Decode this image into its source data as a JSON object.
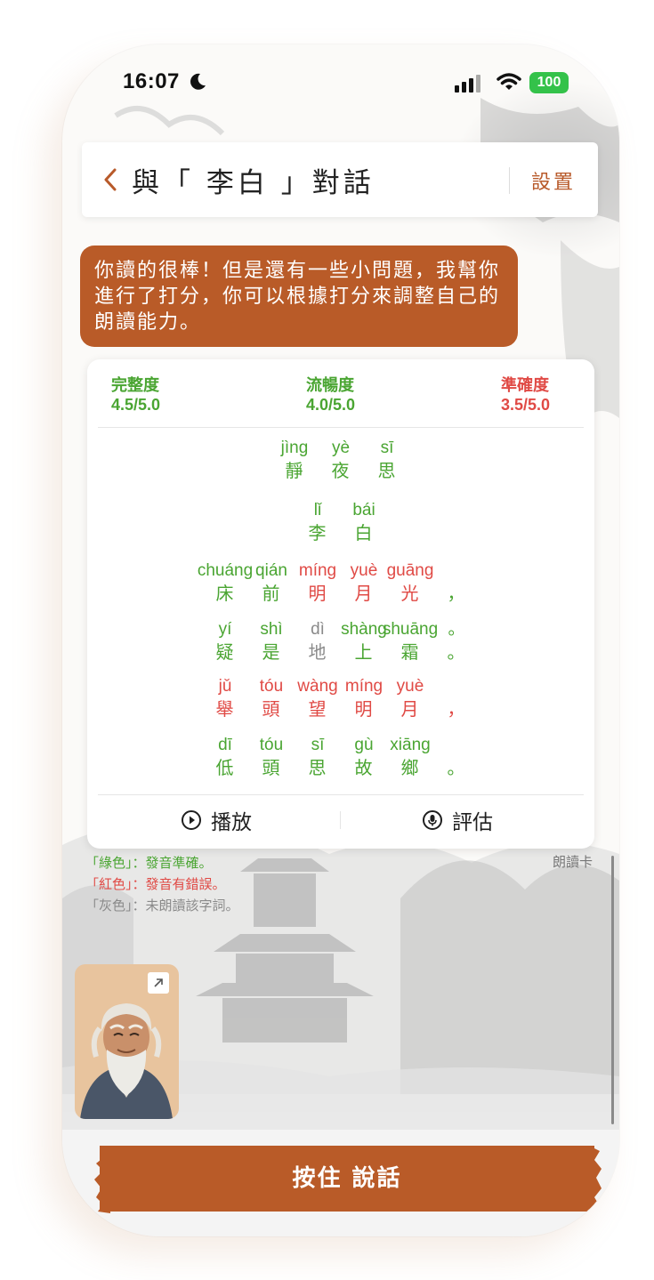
{
  "status_bar": {
    "time": "16:07",
    "battery": "100"
  },
  "nav": {
    "title": "與「 李白 」對話",
    "settings_label": "設置"
  },
  "message": {
    "text": "你讀的很棒！但是還有一些小問題，我幫你進行了打分，你可以根據打分來調整自己的朗讀能力。"
  },
  "scores": [
    {
      "label": "完整度",
      "value": "4.5/5.0"
    },
    {
      "label": "流暢度",
      "value": "4.0/5.0"
    },
    {
      "label": "準確度",
      "value": "3.5/5.0"
    }
  ],
  "poem": {
    "lines": [
      {
        "chars": [
          {
            "py": "jìng",
            "hz": "靜",
            "status": "correct"
          },
          {
            "py": "yè",
            "hz": "夜",
            "status": "correct"
          },
          {
            "py": "sī",
            "hz": "思",
            "status": "correct"
          }
        ]
      },
      {
        "chars": [
          {
            "py": "lǐ",
            "hz": "李",
            "status": "correct"
          },
          {
            "py": "bái",
            "hz": "白",
            "status": "correct"
          }
        ]
      },
      {
        "chars": [
          {
            "py": "chuáng",
            "hz": "床",
            "status": "correct"
          },
          {
            "py": "qián",
            "hz": "前",
            "status": "correct"
          },
          {
            "py": "míng",
            "hz": "明",
            "status": "wrong"
          },
          {
            "py": "yuè",
            "hz": "月",
            "status": "wrong"
          },
          {
            "py": "guāng",
            "hz": "光",
            "status": "wrong"
          },
          {
            "py": "",
            "hz": "，",
            "status": "correct"
          }
        ]
      },
      {
        "chars": [
          {
            "py": "yí",
            "hz": "疑",
            "status": "correct"
          },
          {
            "py": "shì",
            "hz": "是",
            "status": "correct"
          },
          {
            "py": "dì",
            "hz": "地",
            "status": "unread"
          },
          {
            "py": "shàng",
            "hz": "上",
            "status": "correct"
          },
          {
            "py": "shuāng",
            "hz": "霜",
            "status": "correct"
          },
          {
            "py": "。",
            "hz": "。",
            "status": "correct"
          }
        ]
      },
      {
        "chars": [
          {
            "py": "jǔ",
            "hz": "舉",
            "status": "wrong"
          },
          {
            "py": "tóu",
            "hz": "頭",
            "status": "wrong"
          },
          {
            "py": "wàng",
            "hz": "望",
            "status": "wrong"
          },
          {
            "py": "míng",
            "hz": "明",
            "status": "wrong"
          },
          {
            "py": "yuè",
            "hz": "月",
            "status": "wrong"
          },
          {
            "py": "",
            "hz": "，",
            "status": "wrong"
          }
        ]
      },
      {
        "chars": [
          {
            "py": "dī",
            "hz": "低",
            "status": "correct"
          },
          {
            "py": "tóu",
            "hz": "頭",
            "status": "correct"
          },
          {
            "py": "sī",
            "hz": "思",
            "status": "correct"
          },
          {
            "py": "gù",
            "hz": "故",
            "status": "correct"
          },
          {
            "py": "xiāng",
            "hz": "鄉",
            "status": "correct"
          },
          {
            "py": "",
            "hz": "。",
            "status": "correct"
          }
        ]
      }
    ]
  },
  "card_actions": {
    "play_label": "播放",
    "evaluate_label": "評估"
  },
  "legend": [
    {
      "text": "「綠色」：發音準確。",
      "color": "#4aa532"
    },
    {
      "text": "「紅色」：發音有錯誤。",
      "color": "#e04a45"
    },
    {
      "text": "「灰色」：未朗讀該字詞。",
      "color": "#8a8a8a"
    }
  ],
  "reading_card_label": "朗讀卡",
  "talk_button": {
    "label": "按住 說話"
  },
  "colors": {
    "accent": "#b95b28",
    "correct": "#4aa532",
    "wrong": "#e04a45",
    "unread": "#8a8a8a"
  }
}
